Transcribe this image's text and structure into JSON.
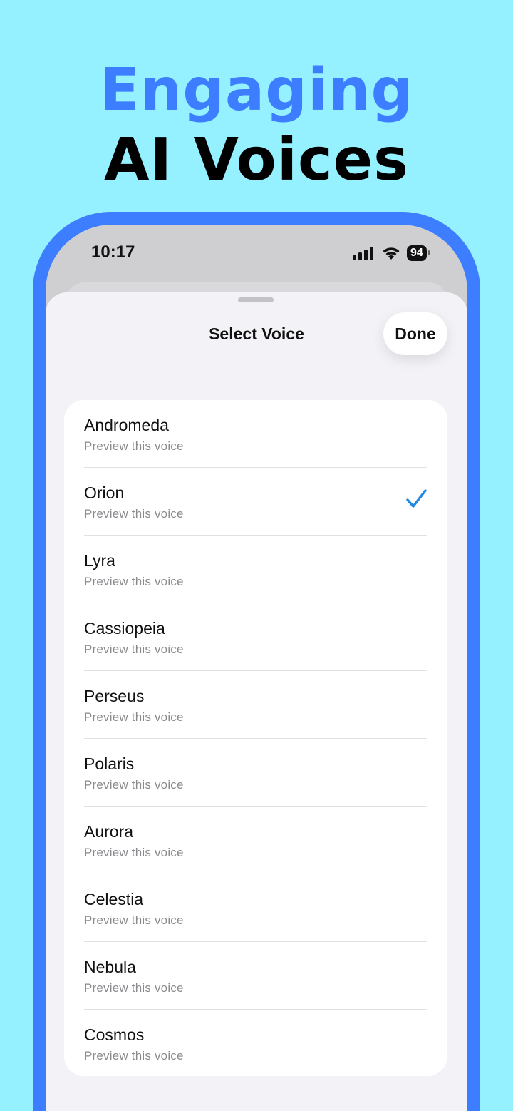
{
  "headline": {
    "line1": "Engaging",
    "line2": "AI Voices"
  },
  "status_bar": {
    "time": "10:17",
    "battery": "94",
    "icons": [
      "signal-icon",
      "wifi-icon",
      "battery-icon"
    ]
  },
  "sheet": {
    "title": "Select Voice",
    "done_label": "Done"
  },
  "voices": [
    {
      "name": "Andromeda",
      "subtitle": "Preview this voice",
      "selected": false
    },
    {
      "name": "Orion",
      "subtitle": "Preview this voice",
      "selected": true
    },
    {
      "name": "Lyra",
      "subtitle": "Preview this voice",
      "selected": false
    },
    {
      "name": "Cassiopeia",
      "subtitle": "Preview this voice",
      "selected": false
    },
    {
      "name": "Perseus",
      "subtitle": "Preview this voice",
      "selected": false
    },
    {
      "name": "Polaris",
      "subtitle": "Preview this voice",
      "selected": false
    },
    {
      "name": "Aurora",
      "subtitle": "Preview this voice",
      "selected": false
    },
    {
      "name": "Celestia",
      "subtitle": "Preview this voice",
      "selected": false
    },
    {
      "name": "Nebula",
      "subtitle": "Preview this voice",
      "selected": false
    },
    {
      "name": "Cosmos",
      "subtitle": "Preview this voice",
      "selected": false
    }
  ],
  "colors": {
    "background": "#95F1FF",
    "accent": "#3D7DFF",
    "check": "#1E88E5"
  }
}
